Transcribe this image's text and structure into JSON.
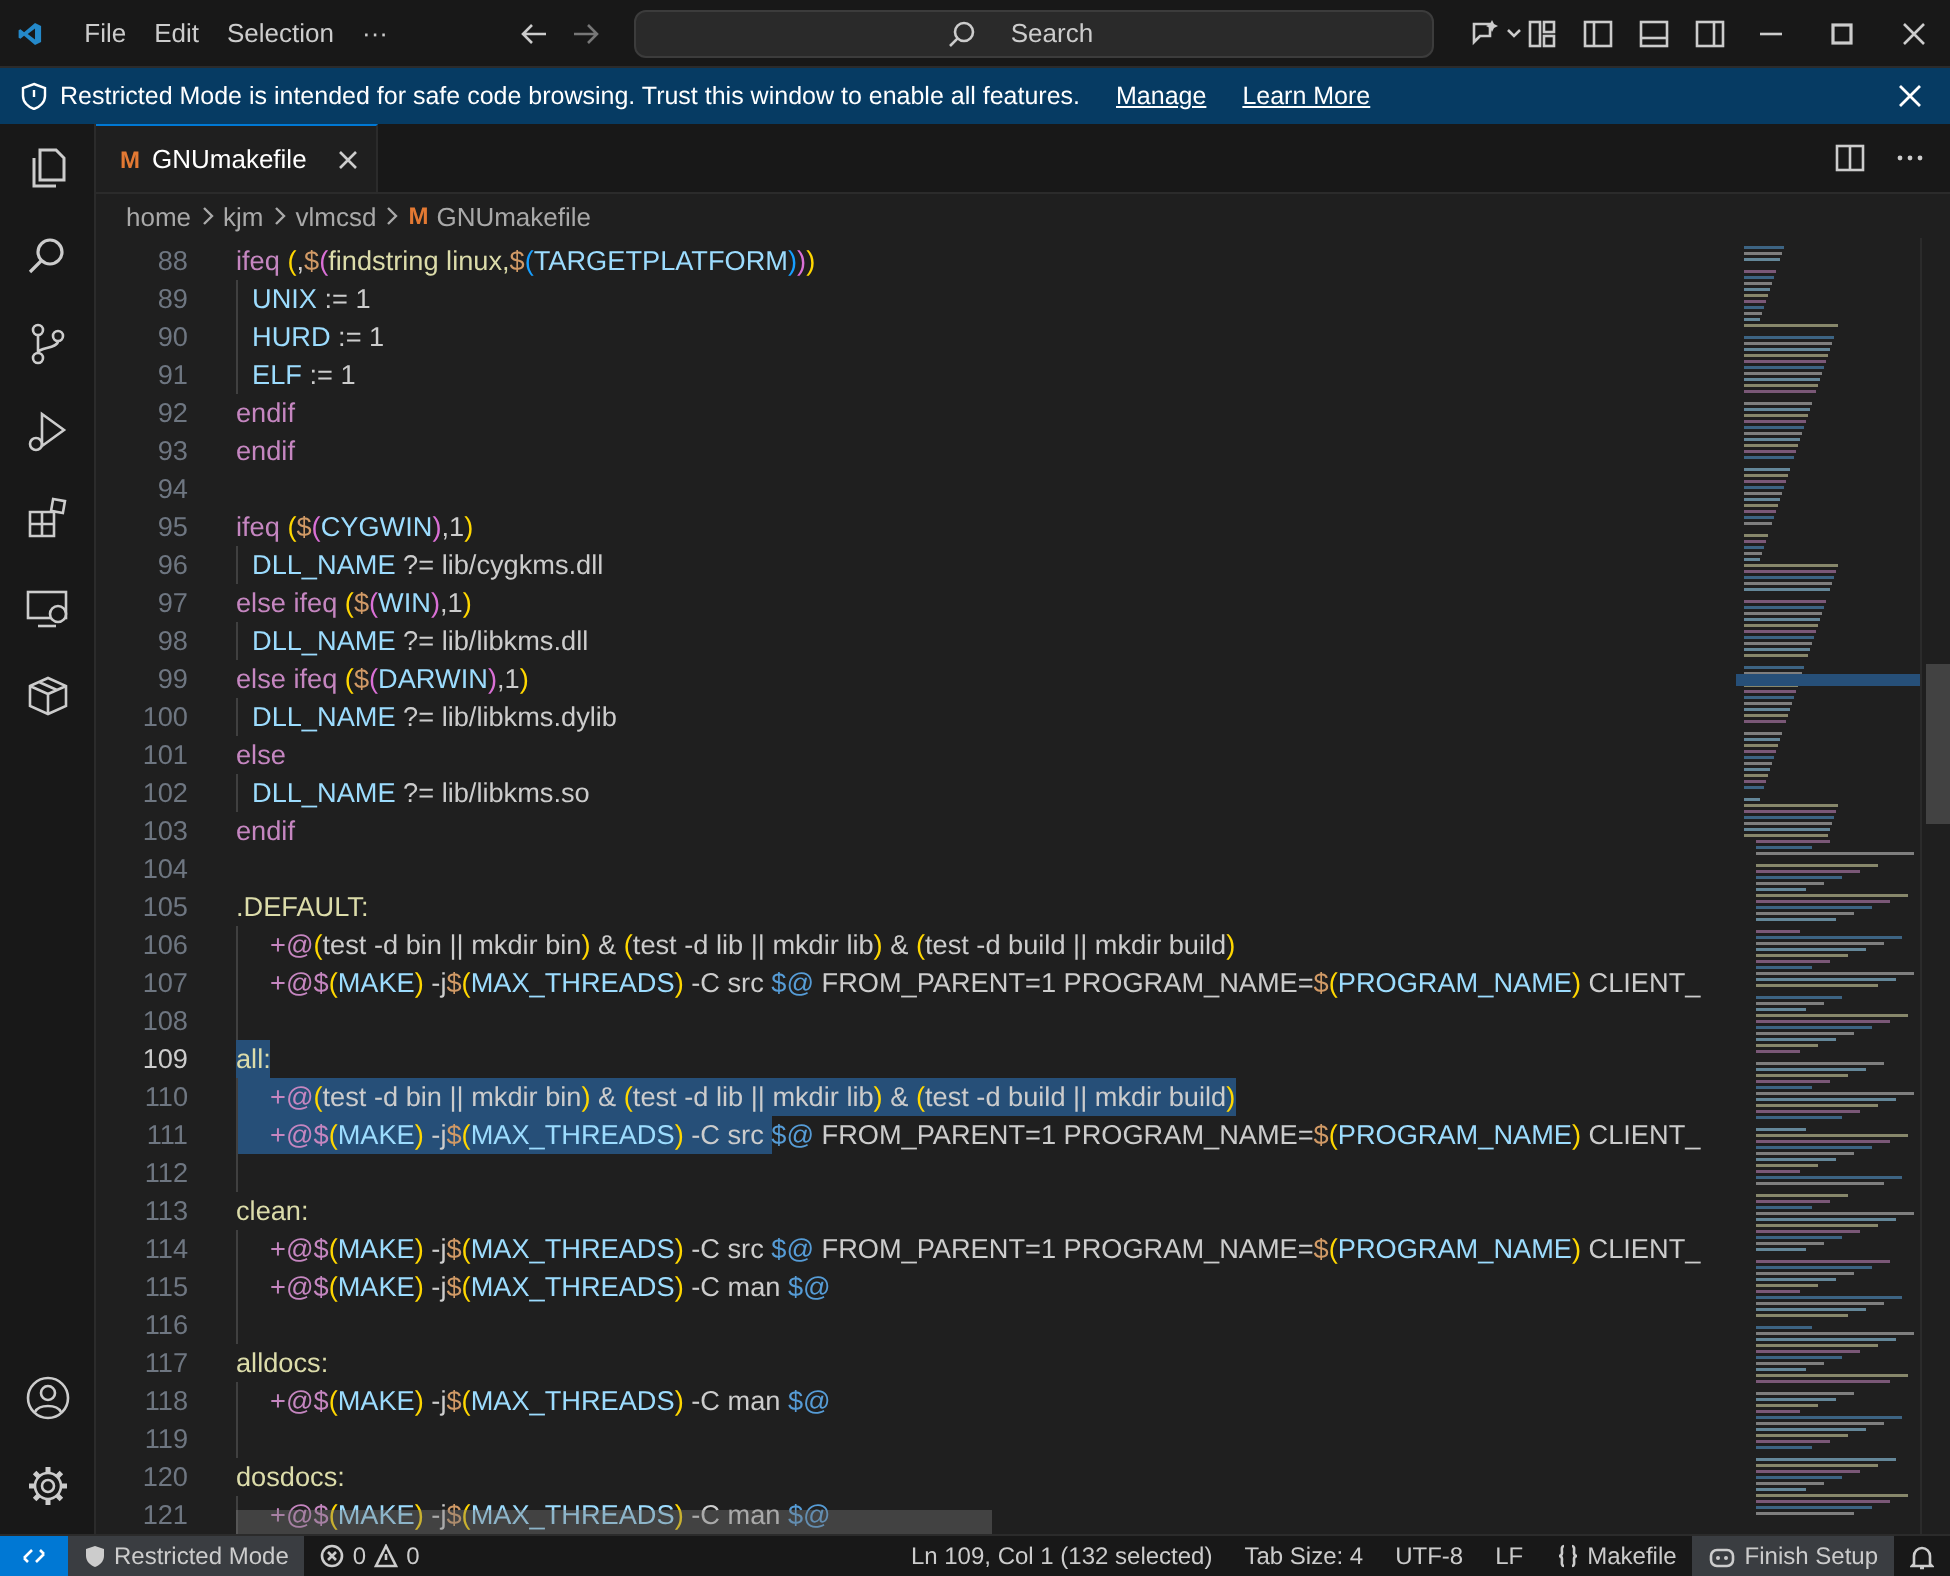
{
  "title_bar": {
    "menus": [
      {
        "label": "File"
      },
      {
        "label": "Edit"
      },
      {
        "label": "Selection"
      },
      {
        "label": "···"
      }
    ],
    "search": {
      "placeholder": "Search"
    }
  },
  "banner": {
    "message": "Restricted Mode is intended for safe code browsing. Trust this window to enable all features.",
    "links": [
      "Manage",
      "Learn More"
    ]
  },
  "tabs": [
    {
      "icon_letter": "M",
      "label": "GNUmakefile",
      "selected": true
    }
  ],
  "breadcrumbs": {
    "folders": [
      "home",
      "kjm",
      "vlmcsd"
    ],
    "file_icon_letter": "M",
    "file": "GNUmakefile"
  },
  "editor": {
    "lines": [
      {
        "number": "88",
        "kind": "top",
        "current": false,
        "tokens": [
          {
            "kind": "kw",
            "text": "ifeq "
          },
          {
            "kind": "b1",
            "text": "("
          },
          {
            "kind": "txt",
            "text": ","
          },
          {
            "kind": "dollar",
            "text": "$"
          },
          {
            "kind": "b2",
            "text": "("
          },
          {
            "kind": "fn",
            "text": "findstring linux,"
          },
          {
            "kind": "dollar",
            "text": "$"
          },
          {
            "kind": "b3",
            "text": "("
          },
          {
            "kind": "var",
            "text": "TARGETPLATFORM"
          },
          {
            "kind": "b3",
            "text": ")"
          },
          {
            "kind": "b2",
            "text": ")"
          },
          {
            "kind": "b1",
            "text": ")"
          }
        ]
      },
      {
        "number": "89",
        "kind": "nested",
        "current": false,
        "tokens": [
          {
            "kind": "var",
            "text": "UNIX"
          },
          {
            "kind": "txt",
            "text": " := 1"
          }
        ]
      },
      {
        "number": "90",
        "kind": "nested",
        "current": false,
        "tokens": [
          {
            "kind": "var",
            "text": "HURD"
          },
          {
            "kind": "txt",
            "text": " := 1"
          }
        ]
      },
      {
        "number": "91",
        "kind": "nested",
        "current": false,
        "tokens": [
          {
            "kind": "var",
            "text": "ELF"
          },
          {
            "kind": "txt",
            "text": " := 1"
          }
        ]
      },
      {
        "number": "92",
        "kind": "top",
        "current": false,
        "tokens": [
          {
            "kind": "kw",
            "text": "endif"
          }
        ]
      },
      {
        "number": "93",
        "kind": "top",
        "current": false,
        "tokens": [
          {
            "kind": "kw",
            "text": "endif"
          }
        ]
      },
      {
        "number": "94",
        "kind": "top",
        "current": false
      },
      {
        "number": "95",
        "kind": "top",
        "current": false,
        "tokens": [
          {
            "kind": "kw",
            "text": "ifeq "
          },
          {
            "kind": "b1",
            "text": "("
          },
          {
            "kind": "dollar",
            "text": "$"
          },
          {
            "kind": "b2",
            "text": "("
          },
          {
            "kind": "var",
            "text": "CYGWIN"
          },
          {
            "kind": "b2",
            "text": ")"
          },
          {
            "kind": "txt",
            "text": ",1"
          },
          {
            "kind": "b1",
            "text": ")"
          }
        ]
      },
      {
        "number": "96",
        "kind": "nested",
        "current": false,
        "tokens": [
          {
            "kind": "var",
            "text": "DLL_NAME"
          },
          {
            "kind": "txt",
            "text": " ?= lib/cygkms.dll"
          }
        ]
      },
      {
        "number": "97",
        "kind": "top",
        "current": false,
        "tokens": [
          {
            "kind": "kw",
            "text": "else ifeq "
          },
          {
            "kind": "b1",
            "text": "("
          },
          {
            "kind": "dollar",
            "text": "$"
          },
          {
            "kind": "b2",
            "text": "("
          },
          {
            "kind": "var",
            "text": "WIN"
          },
          {
            "kind": "b2",
            "text": ")"
          },
          {
            "kind": "txt",
            "text": ",1"
          },
          {
            "kind": "b1",
            "text": ")"
          }
        ]
      },
      {
        "number": "98",
        "kind": "nested",
        "current": false,
        "tokens": [
          {
            "kind": "var",
            "text": "DLL_NAME"
          },
          {
            "kind": "txt",
            "text": " ?= lib/libkms.dll"
          }
        ]
      },
      {
        "number": "99",
        "kind": "top",
        "current": false,
        "tokens": [
          {
            "kind": "kw",
            "text": "else ifeq "
          },
          {
            "kind": "b1",
            "text": "("
          },
          {
            "kind": "dollar",
            "text": "$"
          },
          {
            "kind": "b2",
            "text": "("
          },
          {
            "kind": "var",
            "text": "DARWIN"
          },
          {
            "kind": "b2",
            "text": ")"
          },
          {
            "kind": "txt",
            "text": ",1"
          },
          {
            "kind": "b1",
            "text": ")"
          }
        ]
      },
      {
        "number": "100",
        "kind": "nested",
        "current": false,
        "tokens": [
          {
            "kind": "var",
            "text": "DLL_NAME"
          },
          {
            "kind": "txt",
            "text": " ?= lib/libkms.dylib"
          }
        ]
      },
      {
        "number": "101",
        "kind": "top",
        "current": false,
        "tokens": [
          {
            "kind": "kw",
            "text": "else"
          }
        ]
      },
      {
        "number": "102",
        "kind": "nested",
        "current": false,
        "tokens": [
          {
            "kind": "var",
            "text": "DLL_NAME"
          },
          {
            "kind": "txt",
            "text": " ?= lib/libkms.so"
          }
        ]
      },
      {
        "number": "103",
        "kind": "top",
        "current": false,
        "tokens": [
          {
            "kind": "kw",
            "text": "endif"
          }
        ]
      },
      {
        "number": "104",
        "kind": "top",
        "current": false
      },
      {
        "number": "105",
        "kind": "top",
        "current": false,
        "tokens": [
          {
            "kind": "target",
            "text": ".DEFAULT:"
          }
        ]
      },
      {
        "number": "106",
        "kind": "recipe",
        "current": false,
        "tokens": [
          {
            "kind": "op",
            "text": "+@"
          },
          {
            "kind": "b1",
            "text": "("
          },
          {
            "kind": "txt",
            "text": "test -d bin || mkdir bin"
          },
          {
            "kind": "b1",
            "text": ")"
          },
          {
            "kind": "txt",
            "text": " & "
          },
          {
            "kind": "b1",
            "text": "("
          },
          {
            "kind": "txt",
            "text": "test -d lib || mkdir lib"
          },
          {
            "kind": "b1",
            "text": ")"
          },
          {
            "kind": "txt",
            "text": " & "
          },
          {
            "kind": "b1",
            "text": "("
          },
          {
            "kind": "txt",
            "text": "test -d build || mkdir build"
          },
          {
            "kind": "b1",
            "text": ")"
          }
        ]
      },
      {
        "number": "107",
        "kind": "recipe",
        "current": false,
        "tokens": [
          {
            "kind": "op",
            "text": "+@$"
          },
          {
            "kind": "b1",
            "text": "("
          },
          {
            "kind": "var",
            "text": "MAKE"
          },
          {
            "kind": "b1",
            "text": ")"
          },
          {
            "kind": "txt",
            "text": " -j"
          },
          {
            "kind": "dollar",
            "text": "$"
          },
          {
            "kind": "b1",
            "text": "("
          },
          {
            "kind": "var",
            "text": "MAX_THREADS"
          },
          {
            "kind": "b1",
            "text": ")"
          },
          {
            "kind": "txt",
            "text": " -C src "
          },
          {
            "kind": "auto",
            "text": "$@"
          },
          {
            "kind": "txt",
            "text": " FROM_PARENT=1 PROGRAM_NAME="
          },
          {
            "kind": "dollar",
            "text": "$"
          },
          {
            "kind": "b1",
            "text": "("
          },
          {
            "kind": "var",
            "text": "PROGRAM_NAME"
          },
          {
            "kind": "b1",
            "text": ")"
          },
          {
            "kind": "txt",
            "text": " CLIENT_"
          }
        ]
      },
      {
        "number": "108",
        "kind": "recipe",
        "current": false
      },
      {
        "number": "109",
        "kind": "top",
        "current": true,
        "selected_tokens": [
          {
            "kind": "target",
            "text": "all:"
          }
        ]
      },
      {
        "number": "110",
        "kind": "recipe",
        "current": false,
        "selected_tokens": [
          {
            "kind": "op",
            "text": "+@"
          },
          {
            "kind": "b1",
            "text": "("
          },
          {
            "kind": "txt",
            "text": "test -d bin || mkdir bin"
          },
          {
            "kind": "b1",
            "text": ")"
          },
          {
            "kind": "txt",
            "text": " & "
          },
          {
            "kind": "b1",
            "text": "("
          },
          {
            "kind": "txt",
            "text": "test -d lib || mkdir lib"
          },
          {
            "kind": "b1",
            "text": ")"
          },
          {
            "kind": "txt",
            "text": " & "
          },
          {
            "kind": "b1",
            "text": "("
          },
          {
            "kind": "txt",
            "text": "test -d build || mkdir build"
          },
          {
            "kind": "b1",
            "text": ")"
          }
        ]
      },
      {
        "number": "111",
        "kind": "recipe",
        "current": false,
        "selected_tokens": [
          {
            "kind": "op",
            "text": "+@$"
          },
          {
            "kind": "b1",
            "text": "("
          },
          {
            "kind": "var",
            "text": "MAKE"
          },
          {
            "kind": "b1",
            "text": ")"
          },
          {
            "kind": "txt",
            "text": " -j"
          },
          {
            "kind": "dollar",
            "text": "$"
          },
          {
            "kind": "b1",
            "text": "("
          },
          {
            "kind": "var",
            "text": "MAX_THREADS"
          },
          {
            "kind": "b1",
            "text": ")"
          },
          {
            "kind": "txt",
            "text": " -C src "
          }
        ],
        "tokens": [
          {
            "kind": "auto",
            "text": "$@"
          },
          {
            "kind": "txt",
            "text": " FROM_PARENT=1 PROGRAM_NAME="
          },
          {
            "kind": "dollar",
            "text": "$"
          },
          {
            "kind": "b1",
            "text": "("
          },
          {
            "kind": "var",
            "text": "PROGRAM_NAME"
          },
          {
            "kind": "b1",
            "text": ")"
          },
          {
            "kind": "txt",
            "text": " CLIENT_"
          }
        ]
      },
      {
        "number": "112",
        "kind": "recipe",
        "current": false
      },
      {
        "number": "113",
        "kind": "top",
        "current": false,
        "tokens": [
          {
            "kind": "target",
            "text": "clean:"
          }
        ]
      },
      {
        "number": "114",
        "kind": "recipe",
        "current": false,
        "tokens": [
          {
            "kind": "op",
            "text": "+@$"
          },
          {
            "kind": "b1",
            "text": "("
          },
          {
            "kind": "var",
            "text": "MAKE"
          },
          {
            "kind": "b1",
            "text": ")"
          },
          {
            "kind": "txt",
            "text": " -j"
          },
          {
            "kind": "dollar",
            "text": "$"
          },
          {
            "kind": "b1",
            "text": "("
          },
          {
            "kind": "var",
            "text": "MAX_THREADS"
          },
          {
            "kind": "b1",
            "text": ")"
          },
          {
            "kind": "txt",
            "text": " -C src "
          },
          {
            "kind": "auto",
            "text": "$@"
          },
          {
            "kind": "txt",
            "text": " FROM_PARENT=1 PROGRAM_NAME="
          },
          {
            "kind": "dollar",
            "text": "$"
          },
          {
            "kind": "b1",
            "text": "("
          },
          {
            "kind": "var",
            "text": "PROGRAM_NAME"
          },
          {
            "kind": "b1",
            "text": ")"
          },
          {
            "kind": "txt",
            "text": " CLIENT_"
          }
        ]
      },
      {
        "number": "115",
        "kind": "recipe",
        "current": false,
        "tokens": [
          {
            "kind": "op",
            "text": "+@$"
          },
          {
            "kind": "b1",
            "text": "("
          },
          {
            "kind": "var",
            "text": "MAKE"
          },
          {
            "kind": "b1",
            "text": ")"
          },
          {
            "kind": "txt",
            "text": " -j"
          },
          {
            "kind": "dollar",
            "text": "$"
          },
          {
            "kind": "b1",
            "text": "("
          },
          {
            "kind": "var",
            "text": "MAX_THREADS"
          },
          {
            "kind": "b1",
            "text": ")"
          },
          {
            "kind": "txt",
            "text": " -C man "
          },
          {
            "kind": "auto",
            "text": "$@"
          }
        ]
      },
      {
        "number": "116",
        "kind": "recipe",
        "current": false
      },
      {
        "number": "117",
        "kind": "top",
        "current": false,
        "tokens": [
          {
            "kind": "target",
            "text": "alldocs:"
          }
        ]
      },
      {
        "number": "118",
        "kind": "recipe",
        "current": false,
        "tokens": [
          {
            "kind": "op",
            "text": "+@$"
          },
          {
            "kind": "b1",
            "text": "("
          },
          {
            "kind": "var",
            "text": "MAKE"
          },
          {
            "kind": "b1",
            "text": ")"
          },
          {
            "kind": "txt",
            "text": " -j"
          },
          {
            "kind": "dollar",
            "text": "$"
          },
          {
            "kind": "b1",
            "text": "("
          },
          {
            "kind": "var",
            "text": "MAX_THREADS"
          },
          {
            "kind": "b1",
            "text": ")"
          },
          {
            "kind": "txt",
            "text": " -C man "
          },
          {
            "kind": "auto",
            "text": "$@"
          }
        ]
      },
      {
        "number": "119",
        "kind": "recipe",
        "current": false
      },
      {
        "number": "120",
        "kind": "top",
        "current": false,
        "tokens": [
          {
            "kind": "target",
            "text": "dosdocs:"
          }
        ]
      },
      {
        "number": "121",
        "kind": "recipe",
        "current": false,
        "tokens": [
          {
            "kind": "op",
            "text": "+@$"
          },
          {
            "kind": "b1",
            "text": "("
          },
          {
            "kind": "var",
            "text": "MAKE"
          },
          {
            "kind": "b1",
            "text": ")"
          },
          {
            "kind": "txt",
            "text": " -j"
          },
          {
            "kind": "dollar",
            "text": "$"
          },
          {
            "kind": "b1",
            "text": "("
          },
          {
            "kind": "var",
            "text": "MAX_THREADS"
          },
          {
            "kind": "b1",
            "text": ")"
          },
          {
            "kind": "txt",
            "text": " -C man "
          },
          {
            "kind": "auto",
            "text": "$@"
          }
        ]
      }
    ]
  },
  "status_bar": {
    "restricted": "Restricted Mode",
    "errors": "0",
    "warnings": "0",
    "position": "Ln 109, Col 1 (132 selected)",
    "tab_size": "Tab Size: 4",
    "encoding": "UTF-8",
    "eol": "LF",
    "language": "Makefile",
    "setup": "Finish Setup"
  }
}
